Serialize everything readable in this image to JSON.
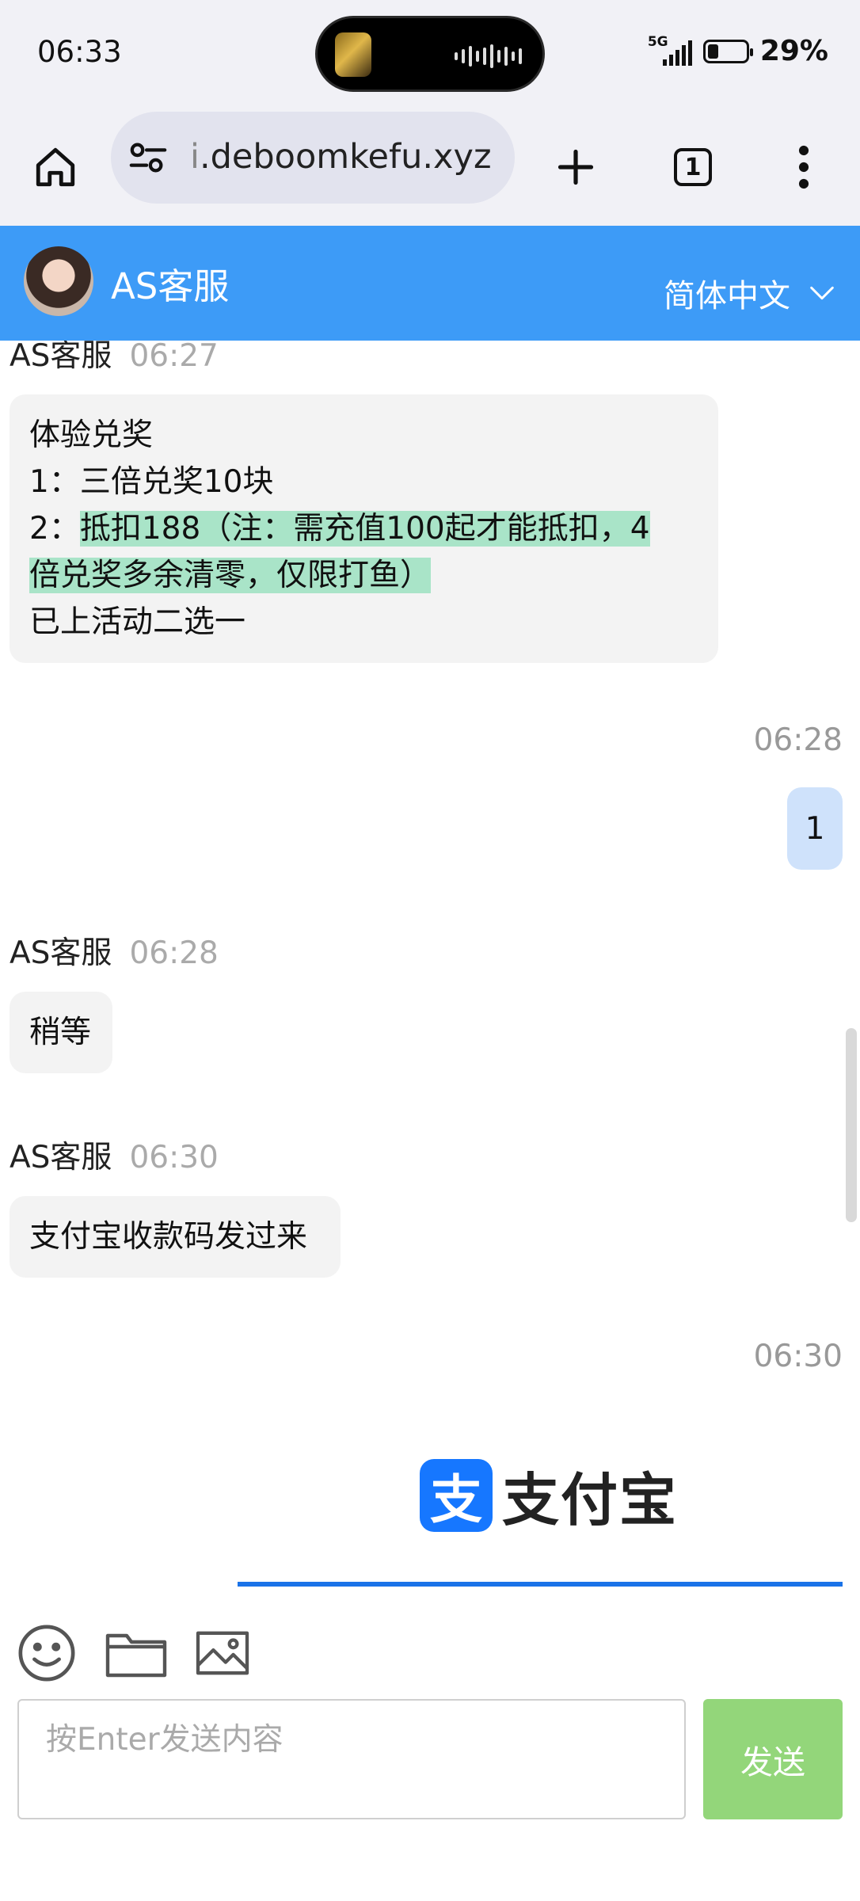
{
  "status_bar": {
    "time": "06:33",
    "network": "5G",
    "battery": "29%",
    "battery_level": 0.29
  },
  "browser": {
    "url_prefix": "i",
    "url_rest": ".deboomkefu.xyz",
    "tab_count": "1",
    "icons": [
      "home-icon",
      "site-settings-icon",
      "new-tab-icon",
      "tab-switcher-icon",
      "more-menu-icon"
    ]
  },
  "header": {
    "title": "AS客服",
    "language": "简体中文"
  },
  "messages": [
    {
      "sender": "AS客服",
      "time": "06:27",
      "line1": "体验兑奖",
      "line2": "1：三倍兑奖10块",
      "line3_prefix": "2：",
      "line3_highlight": "抵扣188（注：需充值100起才能抵扣，4",
      "line4_highlight": "倍兑奖多余清零，仅限打鱼）",
      "line5": "已上活动二选一"
    },
    {
      "time": "06:28",
      "text": "1"
    },
    {
      "sender": "AS客服",
      "time": "06:28",
      "text": "稍等"
    },
    {
      "sender": "AS客服",
      "time": "06:30",
      "text": "支付宝收款码发过来"
    },
    {
      "time": "06:30",
      "logo_glyph": "支",
      "logo_text": "支付宝"
    }
  ],
  "input": {
    "placeholder": "按Enter发送内容",
    "send_label": "发送",
    "tool_icons": [
      "emoji-icon",
      "folder-icon",
      "image-icon"
    ]
  },
  "colors": {
    "header_bg": "#3d9bf7",
    "highlight": "#a9e4c8",
    "out_bubble": "#cfe2fb",
    "send_button": "#93d67a",
    "alipay_blue": "#1677ff"
  }
}
